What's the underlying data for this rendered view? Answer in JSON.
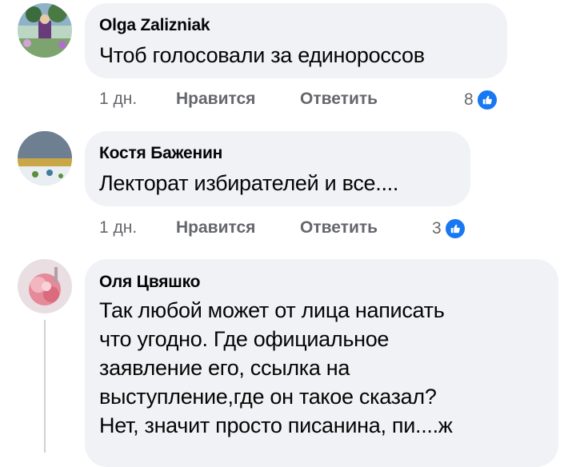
{
  "comments": [
    {
      "author": "Olga Zalizniak",
      "text": "Чтоб голосовали за единороссов",
      "time": "1 дн.",
      "like_label": "Нравится",
      "reply_label": "Ответить",
      "reactions": "8",
      "reaction_icon": "thumbs-up-icon"
    },
    {
      "author": "Костя Баженин",
      "text": "Лекторат избирателей и все....",
      "time": "1 дн.",
      "like_label": "Нравится",
      "reply_label": "Ответить",
      "reactions": "3",
      "reaction_icon": "thumbs-up-icon"
    },
    {
      "author": "Оля Цвяшко",
      "text_lines": [
        "Так любой может от лица написать",
        "что угодно. Где официальное",
        "заявление его, ссылка на",
        "выступление,где он такое сказал?",
        "Нет, значит просто писанина, пи....ж"
      ]
    }
  ],
  "colors": {
    "bubble": "#f0f2f5",
    "meta": "#65676b",
    "accent": "#1877f2"
  }
}
